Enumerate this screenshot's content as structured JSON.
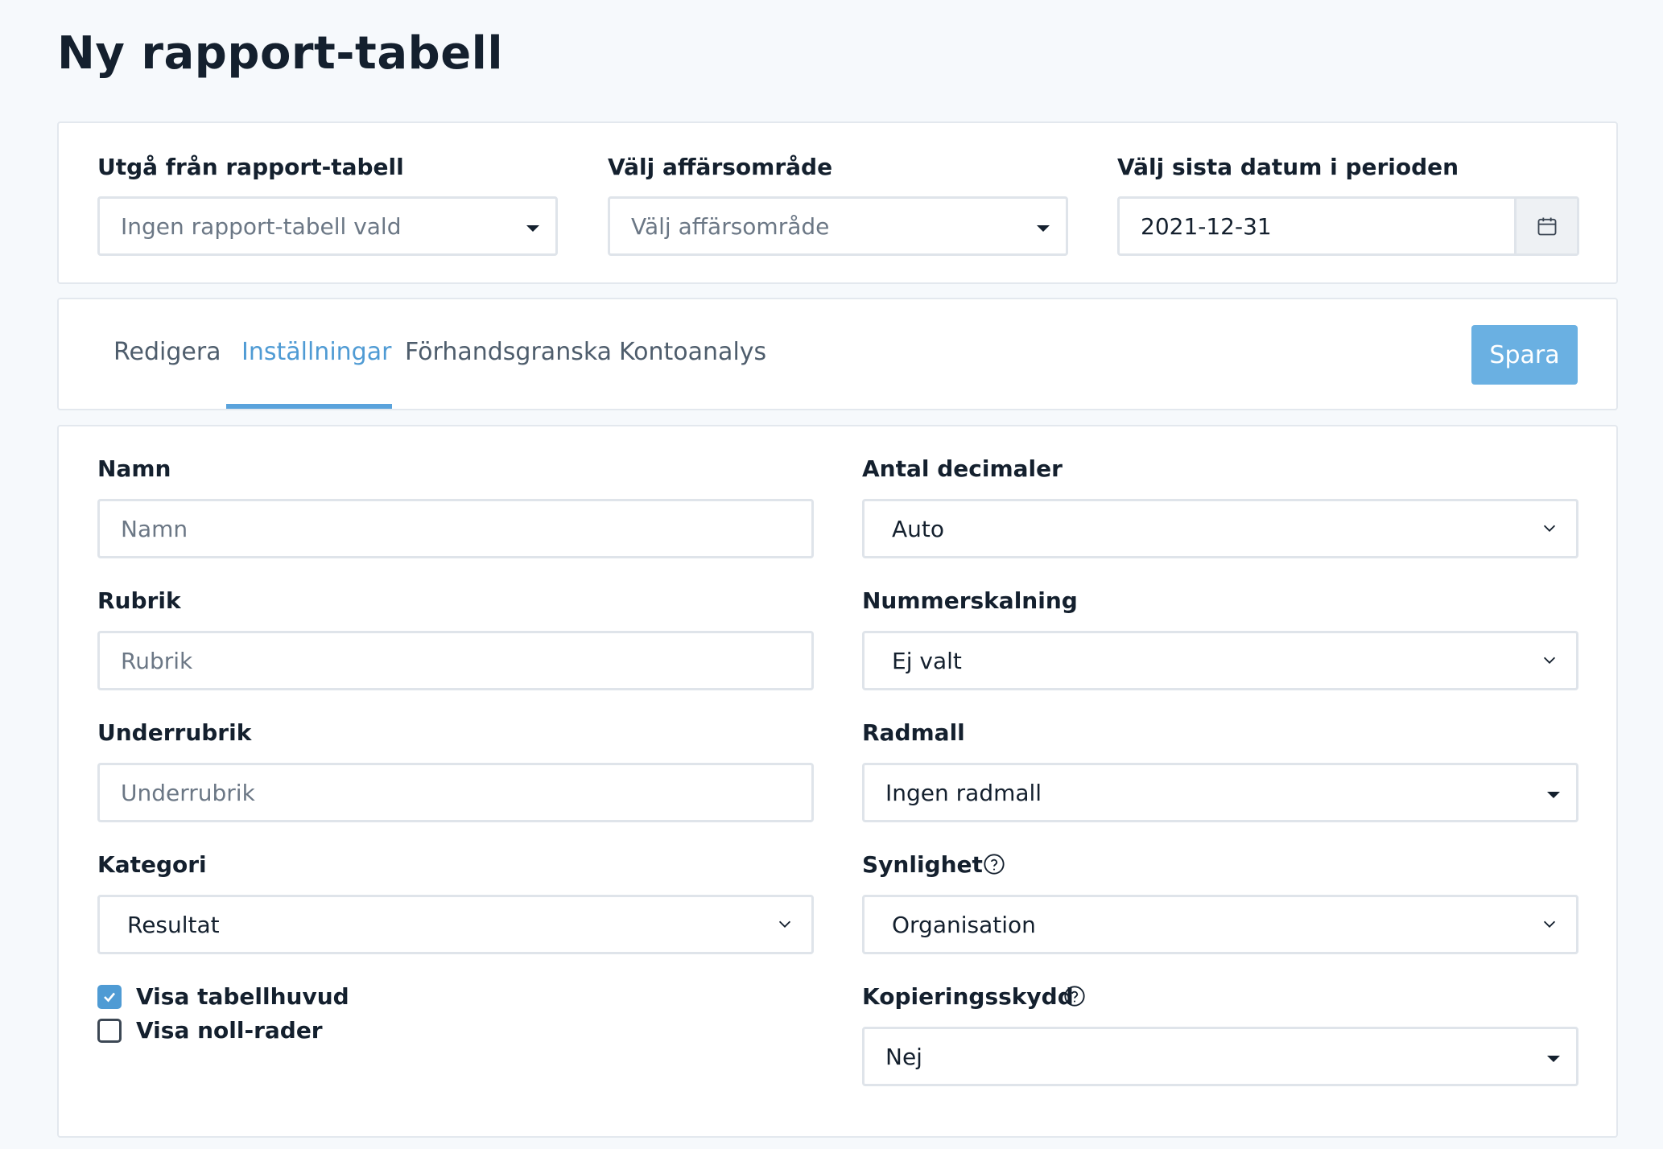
{
  "page": {
    "title": "Ny rapport-tabell"
  },
  "top": {
    "source_table": {
      "label": "Utgå från rapport-tabell",
      "value": "Ingen rapport-tabell vald"
    },
    "business_area": {
      "label": "Välj affärsområde",
      "value": "Välj affärsområde"
    },
    "period_end": {
      "label": "Välj sista datum i perioden",
      "value": "2021-12-31"
    }
  },
  "tabs": {
    "items": [
      {
        "label": "Redigera",
        "active": false
      },
      {
        "label": "Inställningar",
        "active": true
      },
      {
        "label": "Förhandsgranska",
        "active": false
      },
      {
        "label": "Kontoanalys",
        "active": false
      }
    ],
    "save_label": "Spara"
  },
  "form": {
    "name": {
      "label": "Namn",
      "placeholder": "Namn"
    },
    "heading": {
      "label": "Rubrik",
      "placeholder": "Rubrik"
    },
    "subheading": {
      "label": "Underrubrik",
      "placeholder": "Underrubrik"
    },
    "category": {
      "label": "Kategori",
      "value": "Resultat"
    },
    "decimals": {
      "label": "Antal decimaler",
      "value": "Auto"
    },
    "scaling": {
      "label": "Nummerskalning",
      "value": "Ej valt"
    },
    "row_template": {
      "label": "Radmall",
      "value": "Ingen radmall"
    },
    "visibility": {
      "label": "Synlighet",
      "value": "Organisation"
    },
    "copy_protection": {
      "label": "Kopieringsskydd",
      "value": "Nej"
    },
    "show_header": {
      "label": "Visa tabellhuvud",
      "checked": true
    },
    "show_zero_rows": {
      "label": "Visa noll-rader",
      "checked": false
    }
  },
  "colors": {
    "accent": "#4f9bd4",
    "save_button": "#6ab0e2",
    "background": "#f6f9fc"
  }
}
